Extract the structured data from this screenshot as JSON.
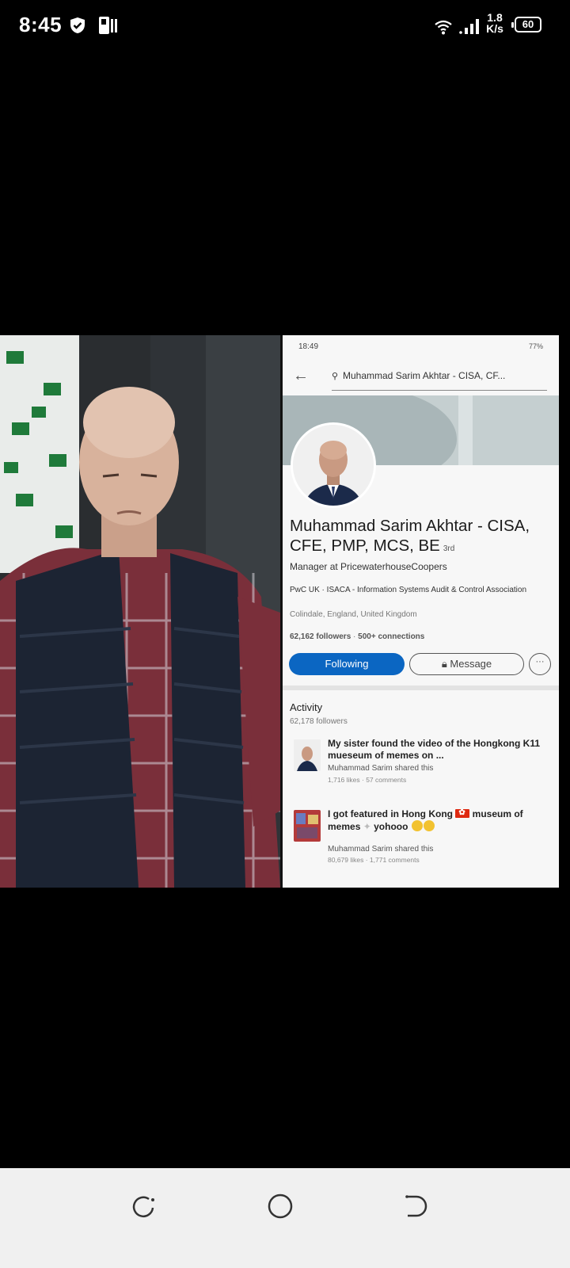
{
  "status_bar": {
    "time": "8:45",
    "net_speed_value": "1.8",
    "net_speed_unit": "K/s",
    "battery": "60",
    "icons": [
      "shield-icon",
      "pip-icon",
      "wifi-icon",
      "signal-icon",
      "battery-icon"
    ]
  },
  "linkedin": {
    "time": "18:49",
    "status": "77%",
    "search_text": "Muhammad Sarim Akhtar - CISA, CF...",
    "name": "Muhammad Sarim Akhtar - CISA, CFE, PMP, MCS, BE",
    "degree": "3rd",
    "headline": "Manager at PricewaterhouseCoopers",
    "company": "PwC UK · ISACA - Information Systems Audit & Control Association",
    "location": "Colindale, England, United Kingdom",
    "followers": "62,162 followers",
    "connections": "500+ connections",
    "following_button": "Following",
    "message_button": "Message",
    "more_button": "···",
    "activity_title": "Activity",
    "activity_followers": "62,178 followers",
    "posts": [
      {
        "title": "My sister found the video of the Hongkong K11 mueseum of memes on ...",
        "shared": "Muhammad Sarim shared this",
        "stats": "1,716 likes · 57 comments"
      },
      {
        "title_part1": "I got featured in Hong Kong",
        "title_part2": "museum of memes",
        "title_part3": "yohooo",
        "shared": "Muhammad Sarim shared this",
        "stats": "80,679 likes · 1,771 comments"
      }
    ]
  },
  "colors": {
    "linkedin_blue": "#0b66c2",
    "navbar_bg": "#f0f0f0"
  },
  "navbar": {
    "icons": [
      "recent-apps-icon",
      "home-icon",
      "back-icon"
    ]
  }
}
